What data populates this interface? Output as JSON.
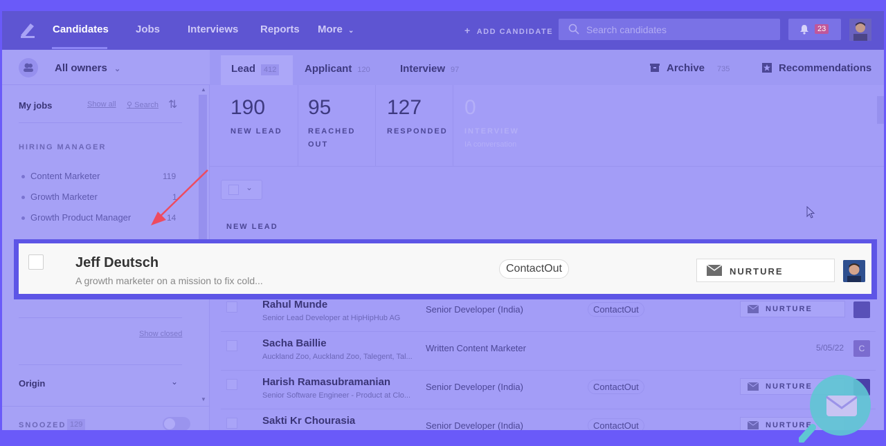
{
  "nav": {
    "items": [
      "Candidates",
      "Jobs",
      "Interviews",
      "Reports",
      "More"
    ],
    "add_candidate": "ADD CANDIDATE",
    "search_placeholder": "Search candidates",
    "notifications": "23"
  },
  "owners": {
    "label": "All owners"
  },
  "tabs": [
    {
      "label": "Lead",
      "count": "412"
    },
    {
      "label": "Applicant",
      "count": "120"
    },
    {
      "label": "Interview",
      "count": "97"
    },
    {
      "label": "Archive",
      "count": "735"
    },
    {
      "label": "Recommendations"
    }
  ],
  "sidebar": {
    "my_jobs": "My jobs",
    "show_all": "Show all",
    "search": "Search",
    "hiring_manager": "HIRING MANAGER",
    "jobs": [
      {
        "name": "Content Marketer",
        "count": "119"
      },
      {
        "name": "Growth Marketer",
        "count": "1"
      },
      {
        "name": "Growth Product Manager",
        "count": "14"
      }
    ],
    "show_closed": "Show closed",
    "origin": "Origin",
    "snoozed": "SNOOZED",
    "snoozed_count": "129"
  },
  "stats": [
    {
      "num": "190",
      "label1": "NEW LEAD",
      "label2": ""
    },
    {
      "num": "95",
      "label1": "REACHED",
      "label2": "OUT"
    },
    {
      "num": "127",
      "label1": "RESPONDED",
      "label2": ""
    },
    {
      "num": "0",
      "label1": "INTERVIEW",
      "label2": "",
      "sub": "IA conversation"
    }
  ],
  "section": "NEW LEAD",
  "highlight": {
    "name": "Jeff Deutsch",
    "desc": "A growth marketer on a mission to fix cold...",
    "source": "ContactOut",
    "status": "NURTURE"
  },
  "rows": [
    {
      "name": "Rahul Munde",
      "desc": "Senior Lead Developer at HipHipHub AG",
      "job": "Senior Developer (India)",
      "source": "ContactOut",
      "status": "NURTURE",
      "date": "",
      "avatar": ""
    },
    {
      "name": "Sacha Baillie",
      "desc": "Auckland Zoo, Auckland Zoo, Talegent, Tal...",
      "job": "Written Content Marketer",
      "source": "",
      "status": "",
      "date": "5/05/22",
      "avatar": "C"
    },
    {
      "name": "Harish Ramasubramanian",
      "desc": "Senior Software Engineer - Product at Clo...",
      "job": "Senior Developer (India)",
      "source": "ContactOut",
      "status": "NURTURE",
      "date": "",
      "avatar": ""
    },
    {
      "name": "Sakti Kr Chourasia",
      "desc": "",
      "job": "Senior Developer (India)",
      "source": "ContactOut",
      "status": "NURTURE",
      "date": "",
      "avatar": ""
    }
  ]
}
